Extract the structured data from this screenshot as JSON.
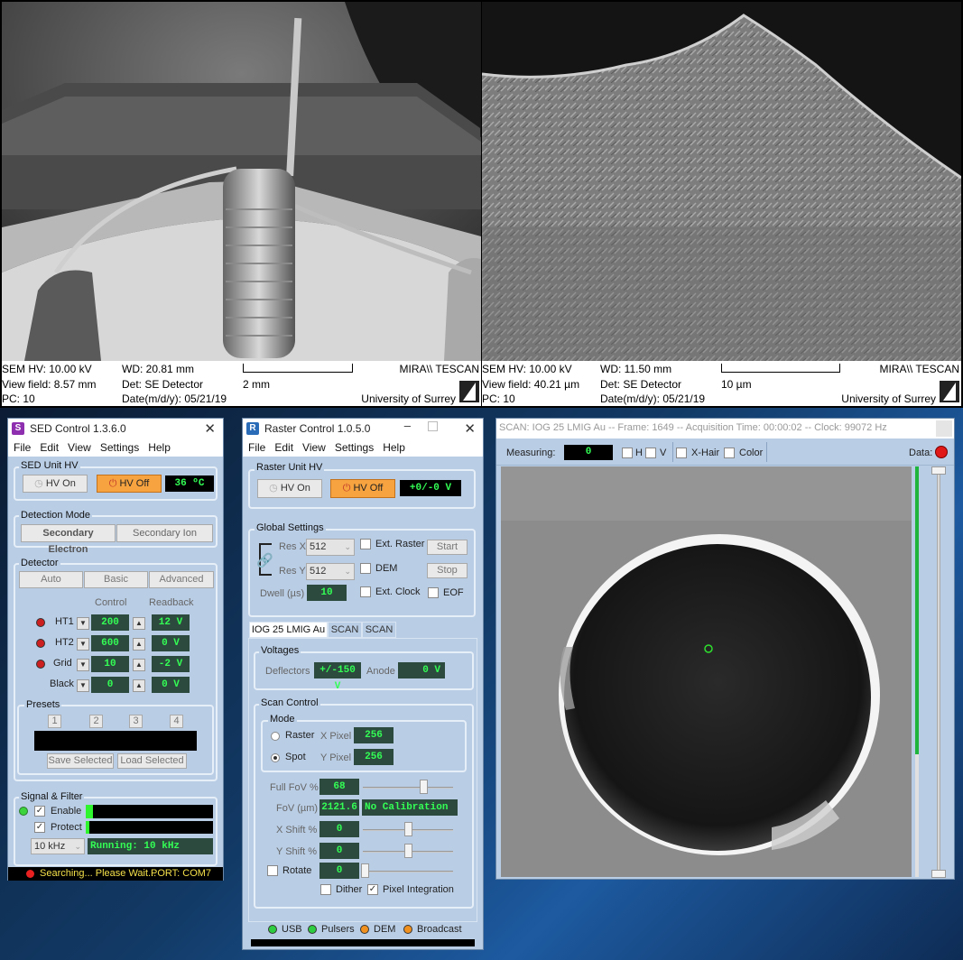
{
  "sem_left": {
    "hv": "SEM HV: 10.00 kV",
    "wd": "WD: 20.81 mm",
    "brand": "MIRA\\\\ TESCAN",
    "view_field": "View field: 8.57 mm",
    "det": "Det: SE Detector",
    "scale": "2 mm",
    "pc": "PC:  10",
    "date": "Date(m/d/y): 05/21/19",
    "institution": "University of Surrey"
  },
  "sem_right": {
    "hv": "SEM HV: 10.00 kV",
    "wd": "WD: 11.50 mm",
    "brand": "MIRA\\\\ TESCAN",
    "view_field": "View field: 40.21 µm",
    "det": "Det: SE Detector",
    "scale": "10 µm",
    "pc": "PC:  10",
    "date": "Date(m/d/y): 05/21/19",
    "institution": "University of Surrey"
  },
  "sed": {
    "title": "SED Control 1.3.6.0",
    "icon_letter": "S",
    "menu": [
      "File",
      "Edit",
      "View",
      "Settings",
      "Help"
    ],
    "unit_hv_label": "SED Unit HV",
    "hv_on": "HV On",
    "hv_off": "HV Off",
    "temp": "36 ºC",
    "detection_mode_label": "Detection Mode",
    "mode_secondary_electron": "Secondary Electron",
    "mode_secondary_ion": "Secondary Ion",
    "detector_label": "Detector",
    "det_tabs": [
      "Auto",
      "Basic",
      "Advanced"
    ],
    "col_control": "Control",
    "col_readback": "Readback",
    "rows": [
      {
        "name": "HT1",
        "control": "200",
        "readback": "12 V",
        "led": true
      },
      {
        "name": "HT2",
        "control": "600",
        "readback": "0 V",
        "led": true
      },
      {
        "name": "Grid",
        "control": "10",
        "readback": "-2 V",
        "led": true
      },
      {
        "name": "Black",
        "control": "0",
        "readback": "0 V",
        "led": false
      }
    ],
    "presets_label": "Presets",
    "presets": [
      "1",
      "2",
      "3",
      "4"
    ],
    "save_selected": "Save Selected",
    "load_selected": "Load Selected",
    "signal_label": "Signal & Filter",
    "enable": "Enable",
    "protect": "Protect",
    "enable_level": 0.06,
    "protect_level": 0.03,
    "filter": "10 kHz",
    "running": "Running: 10 kHz",
    "status": "Searching... Please Wait...",
    "port": "PORT: COM7"
  },
  "raster": {
    "title": "Raster Control 1.0.5.0",
    "icon_letter": "R",
    "menu": [
      "File",
      "Edit",
      "View",
      "Settings",
      "Help"
    ],
    "unit_hv_label": "Raster Unit HV",
    "hv_on": "HV On",
    "hv_off": "HV Off",
    "hv_readout": "+0/-0 V",
    "global_label": "Global Settings",
    "res_x_label": "Res X",
    "res_x": "512",
    "res_y_label": "Res Y",
    "res_y": "512",
    "dwell_label": "Dwell (µs)",
    "dwell": "10",
    "ext_raster": "Ext. Raster",
    "dem": "DEM",
    "ext_clock": "Ext. Clock",
    "start": "Start",
    "stop": "Stop",
    "eof": "EOF",
    "tabs": [
      "IOG 25 LMIG Au",
      "SCAN",
      "SCAN"
    ],
    "voltages_label": "Voltages",
    "deflectors_label": "Deflectors",
    "deflectors": "+/-150 V",
    "anode_label": "Anode",
    "anode": "0 V",
    "scan_control_label": "Scan Control",
    "mode_label": "Mode",
    "raster_opt": "Raster",
    "spot_opt": "Spot",
    "x_pixel_label": "X Pixel",
    "x_pixel": "256",
    "y_pixel_label": "Y Pixel",
    "y_pixel": "256",
    "full_fov_label": "Full FoV %",
    "full_fov": "68",
    "fov_um_label": "FoV (µm)",
    "fov_um": "2121.6",
    "calibration": "No Calibration",
    "x_shift_label": "X Shift %",
    "x_shift": "0",
    "y_shift_label": "Y Shift %",
    "y_shift": "0",
    "rotate_label": "Rotate",
    "rotate": "0",
    "dither": "Dither",
    "pixel_integration": "Pixel Integration",
    "status_items": [
      {
        "label": "USB",
        "color": "#2ecc40"
      },
      {
        "label": "Pulsers",
        "color": "#2ecc40"
      },
      {
        "label": "DEM",
        "color": "#f0901e"
      },
      {
        "label": "Broadcast",
        "color": "#f0901e"
      }
    ]
  },
  "scan": {
    "title": "SCAN: IOG 25 LMIG Au -- Frame: 1649 -- Acquisition Time: 00:00:02 -- Clock: 99072 Hz",
    "measuring_label": "Measuring:",
    "measuring": "0",
    "h": "H",
    "v": "V",
    "xhair": "X-Hair",
    "color": "Color",
    "data_label": "Data:",
    "level": 0.7
  },
  "colors": {
    "panel_bg": "#b9cde5",
    "lcd_green": "#33ff55",
    "orange": "#f7a33f",
    "red_led": "#cc1f1f"
  }
}
